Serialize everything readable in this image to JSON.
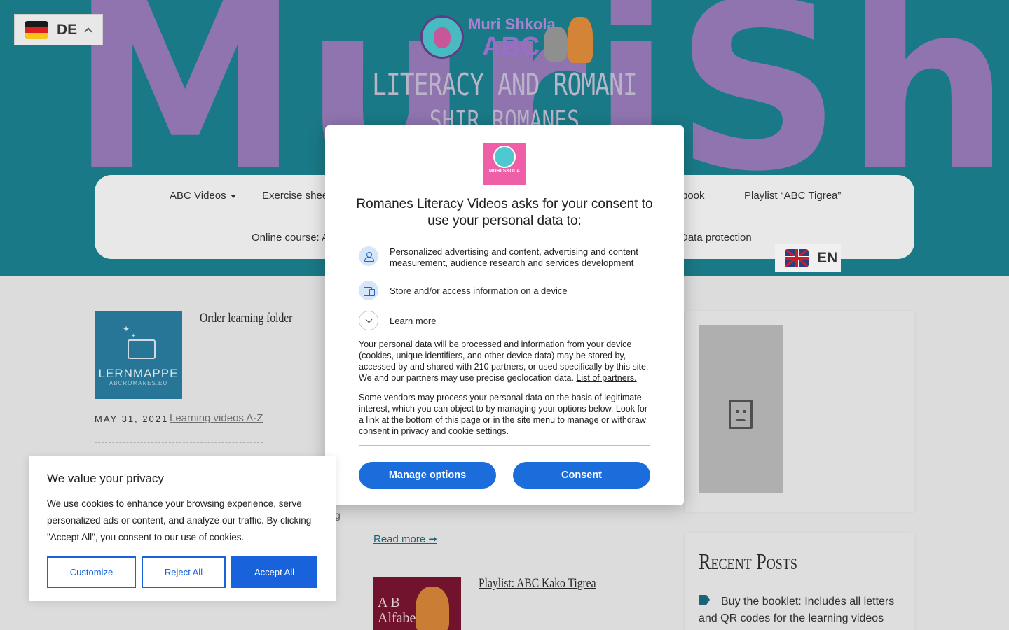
{
  "header": {
    "background_word": "MuriShkola",
    "logo": {
      "line1": "Muri Shkola",
      "line2": "ABC"
    },
    "site_title": "Literacy and Romani",
    "site_subtitle": "Shir Romanes",
    "bg_color": "#1d8391"
  },
  "language_switcher": {
    "current": "DE",
    "alternate": "EN"
  },
  "nav": {
    "items": [
      {
        "label": "ABC Videos",
        "has_dropdown": true
      },
      {
        "label": "Exercise shee"
      },
      {
        "label": "book"
      },
      {
        "label": "Playlist “ABC Tigrea”"
      },
      {
        "label": "Online course: A"
      },
      {
        "label": "Data protection"
      }
    ]
  },
  "posts": [
    {
      "title": "Order learning folder",
      "thumb_text": "LERNMAPPE",
      "thumb_sub": "ABCROMANES.EU",
      "date": "MAY 31, 2021",
      "category": "Learning videos A-Z"
    },
    {
      "excerpt_tail": "...",
      "read_more": "Read more ➞",
      "title": "Playlist: ABC Kako Tigrea",
      "thumb_text": "A B\nAlfabe"
    }
  ],
  "stray_text": "g",
  "sidebar": {
    "recent_posts_title": "Recent Posts",
    "recent_posts": [
      "Buy the booklet: Includes all letters and QR codes for the learning videos"
    ]
  },
  "consent_dialog": {
    "logo_text": "MURI SKOLA",
    "heading": "Romanes Literacy Videos asks for your consent to use your personal data to:",
    "purposes": [
      {
        "icon": "person-icon",
        "text": "Personalized advertising and content, advertising and content measurement, audience research and services development"
      },
      {
        "icon": "device-icon",
        "text": "Store and/or access information on a device"
      }
    ],
    "learn_more": "Learn more",
    "paragraph1": "Your personal data will be processed and information from your device (cookies, unique identifiers, and other device data) may be stored by, accessed by and shared with 210 partners, or used specifically by this site. We and our partners may use precise geolocation data.",
    "partners_link": "List of partners.",
    "paragraph2": "Some vendors may process your personal data on the basis of legitimate interest, which you can object to by managing your options below. Look for a link at the bottom of this page or in the site menu to manage or withdraw consent in privacy and cookie settings.",
    "manage_button": "Manage options",
    "consent_button": "Consent",
    "accent_color": "#1a6ddb"
  },
  "cookie_banner": {
    "title": "We value your privacy",
    "text": "We use cookies to enhance your browsing experience, serve personalized ads or content, and analyze our traffic. By clicking \"Accept All\", you consent to our use of cookies.",
    "customize": "Customize",
    "reject": "Reject All",
    "accept": "Accept All",
    "accent_color": "#1863dc"
  }
}
